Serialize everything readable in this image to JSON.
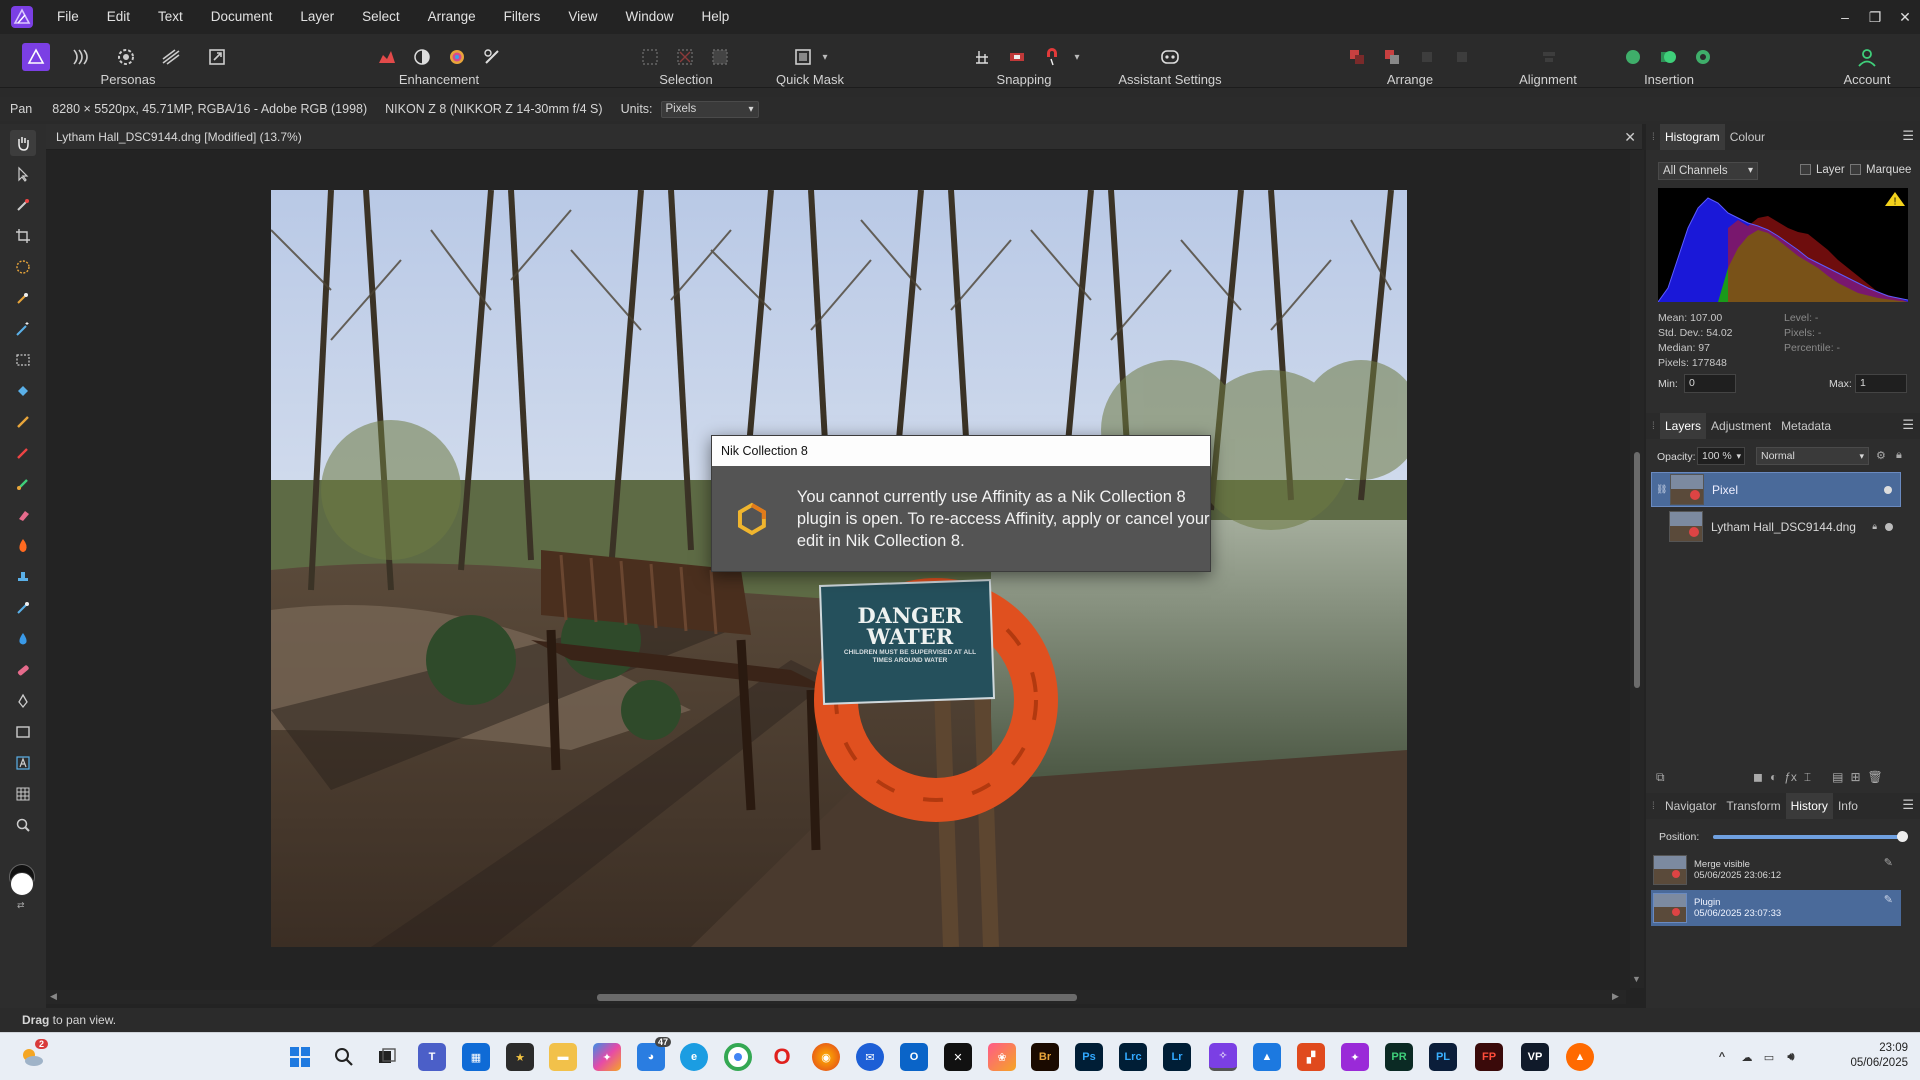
{
  "menubar": {
    "items": [
      "File",
      "Edit",
      "Text",
      "Document",
      "Layer",
      "Select",
      "Arrange",
      "Filters",
      "View",
      "Window",
      "Help"
    ]
  },
  "toolbar": {
    "groups": {
      "personas": "Personas",
      "enhancement": "Enhancement",
      "selection": "Selection",
      "quick_mask": "Quick Mask",
      "snapping": "Snapping",
      "assistant": "Assistant Settings",
      "arrange": "Arrange",
      "alignment": "Alignment",
      "insertion": "Insertion",
      "account": "Account"
    }
  },
  "context": {
    "tool": "Pan",
    "image_info": "8280 × 5520px, 45.71MP, RGBA/16 - Adobe RGB (1998)",
    "camera": "NIKON Z 8 (NIKKOR Z 14-30mm f/4 S)",
    "units_label": "Units:",
    "units_value": "Pixels"
  },
  "document": {
    "tab_title": "Lytham Hall_DSC9144.dng [Modified] (13.7%)",
    "sign_line1": "DANGER",
    "sign_line2": "WATER",
    "sign_small": "CHILDREN MUST BE SUPERVISED AT ALL TIMES AROUND WATER"
  },
  "dialog": {
    "title": "Nik Collection 8",
    "message": "You cannot currently use Affinity as a Nik Collection 8 plugin is open. To re-access Affinity, apply or cancel your edit in Nik Collection 8."
  },
  "histogram": {
    "tabs": [
      "Histogram",
      "Colour"
    ],
    "channel": "All Channels",
    "layer_label": "Layer",
    "marquee_label": "Marquee",
    "mean": "Mean: 107.00",
    "std": "Std. Dev.: 54.02",
    "median": "Median: 97",
    "pixels": "Pixels: 177848",
    "level": "Level: -",
    "pixels_r": "Pixels: -",
    "percentile": "Percentile: -",
    "min_label": "Min:",
    "min_value": "0",
    "max_label": "Max:",
    "max_value": "1"
  },
  "layers": {
    "tabs": [
      "Layers",
      "Adjustment",
      "Metadata"
    ],
    "opacity_label": "Opacity:",
    "opacity_value": "100 %",
    "blend_mode": "Normal",
    "items": [
      {
        "name": "Pixel"
      },
      {
        "name": "Lytham Hall_DSC9144.dng"
      }
    ]
  },
  "history": {
    "tabs": [
      "Navigator",
      "Transform",
      "History",
      "Info"
    ],
    "position_label": "Position:",
    "position": 1.0,
    "items": [
      {
        "name": "Merge visible",
        "time": "05/06/2025 23:06:12"
      },
      {
        "name": "Plugin",
        "time": "05/06/2025 23:07:33"
      }
    ]
  },
  "status": {
    "bold": "Drag",
    "text": " to pan view."
  },
  "taskbar": {
    "notification_badge": "2",
    "teams_badge": "47",
    "time": "23:09",
    "date": "05/06/2025",
    "app_labels": [
      "Br",
      "Ps",
      "Lrc",
      "Lr",
      "PR",
      "PL",
      "FP",
      "VP"
    ]
  },
  "colors": {
    "accent": "#7b3fe4",
    "selected_row": "#4a6a9a",
    "panel_bg": "#2d2d2d",
    "taskbar_bg": "#e9eef5"
  }
}
